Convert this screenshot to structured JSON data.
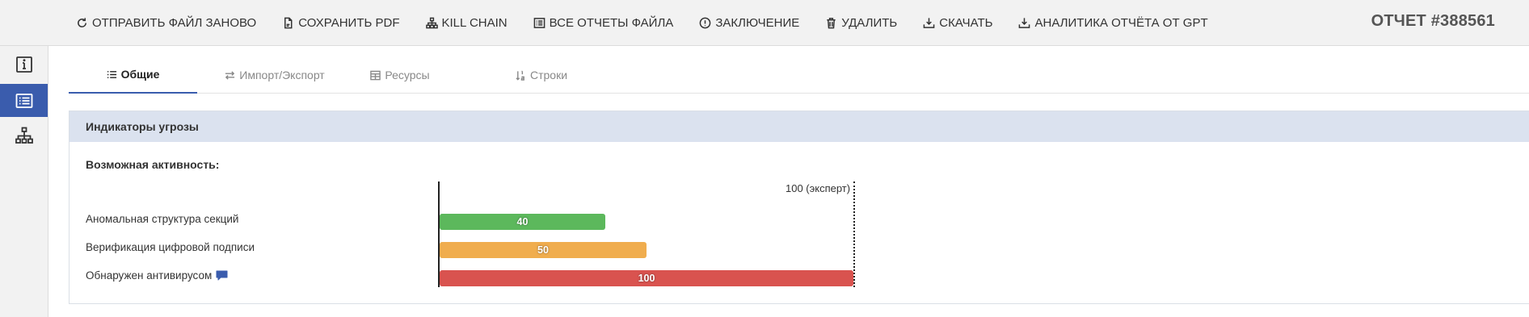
{
  "toolbar": {
    "buttons": [
      {
        "label": "ОТПРАВИТЬ ФАЙЛ ЗАНОВО",
        "icon": "refresh-icon"
      },
      {
        "label": "СОХРАНИТЬ PDF",
        "icon": "file-pdf-icon"
      },
      {
        "label": "KILL CHAIN",
        "icon": "sitemap-icon"
      },
      {
        "label": "ВСЕ ОТЧЕТЫ ФАЙЛА",
        "icon": "list-alt-icon"
      },
      {
        "label": "ЗАКЛЮЧЕНИЕ",
        "icon": "exclamation-circle-icon"
      },
      {
        "label": "УДАЛИТЬ",
        "icon": "trash-icon"
      },
      {
        "label": "СКАЧАТЬ",
        "icon": "download-icon"
      },
      {
        "label": "АНАЛИТИКА ОТЧЁТА ОТ GPT",
        "icon": "download-icon"
      }
    ],
    "report_number": "ОТЧЕТ #388561"
  },
  "sidebar": {
    "items": [
      {
        "icon": "info-icon",
        "active": false
      },
      {
        "icon": "list-icon",
        "active": true
      },
      {
        "icon": "sitemap-icon",
        "active": false
      }
    ]
  },
  "tabs": [
    {
      "label": "Общие",
      "icon": "list-ul-icon",
      "active": true
    },
    {
      "label": "Импорт/Экспорт",
      "icon": "exchange-icon",
      "active": false
    },
    {
      "label": "Ресурсы",
      "icon": "table-icon",
      "active": false
    },
    {
      "label": "Строки",
      "icon": "sort-numeric-icon",
      "active": false
    }
  ],
  "panel": {
    "title": "Индикаторы угрозы",
    "subtitle": "Возможная активность:",
    "max_label": "100 (эксперт)",
    "max_value": 100,
    "rows": [
      {
        "label": "Аномальная структура секций",
        "value": 40,
        "value_text": "40",
        "color": "#5cb85c",
        "has_comment": false
      },
      {
        "label": "Верификация цифровой подписи",
        "value": 50,
        "value_text": "50",
        "color": "#f0ad4e",
        "has_comment": false
      },
      {
        "label": "Обнаружен антивирусом",
        "value": 100,
        "value_text": "100",
        "color": "#d9534f",
        "has_comment": true
      }
    ]
  },
  "colors": {
    "accent": "#3a5cad",
    "panel_header": "#dbe2ef",
    "toolbar_bg": "#f2f2f2"
  }
}
